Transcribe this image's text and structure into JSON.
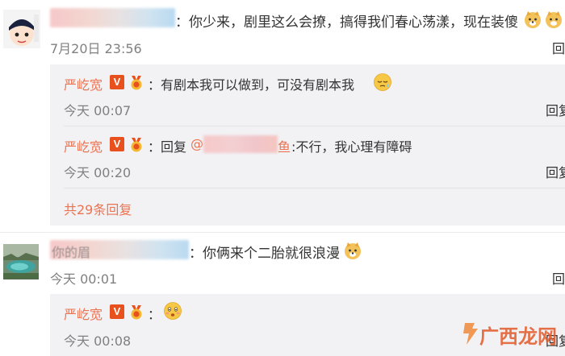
{
  "comments": [
    {
      "text": "：你少来，剧里这么会撩，搞得我们春心荡漾，现在装傻",
      "time": "7月20日 23:56",
      "replies": [
        {
          "user": "严屹宽",
          "text": "：有剧本我可以做到，可没有剧本我",
          "time": "今天 00:07",
          "reply_label": "回复"
        },
        {
          "user": "严屹宽",
          "text_prefix": "：回复",
          "mention_prefix": "@",
          "mention_suffix": "鱼",
          "text": ":不行，我心理有障碍",
          "time": "今天 00:20",
          "reply_label": "回复"
        }
      ],
      "more_replies": "共29条回复"
    },
    {
      "name_visible": "你的眉",
      "text": "：你俩来个二胎就很浪漫",
      "time": "今天 00:01",
      "replies": [
        {
          "user": "严屹宽",
          "text": "：",
          "time": "今天 00:08",
          "reply_label": "回复"
        }
      ]
    }
  ],
  "badges": {
    "verified": "V"
  },
  "watermark": {
    "text": "广西龙网"
  },
  "icons": {
    "verified": "verified-v-icon",
    "medal": "medal-badge-icon",
    "emoji_doge": "doge-emoji-icon",
    "emoji_sleepy": "sleepy-emoji-icon",
    "emoji_flushed": "flushed-emoji-icon"
  },
  "colors": {
    "username": "#eb7350",
    "meta": "#808080",
    "reply_bg": "#f2f2f5",
    "verified_bg": "#e8501d"
  }
}
